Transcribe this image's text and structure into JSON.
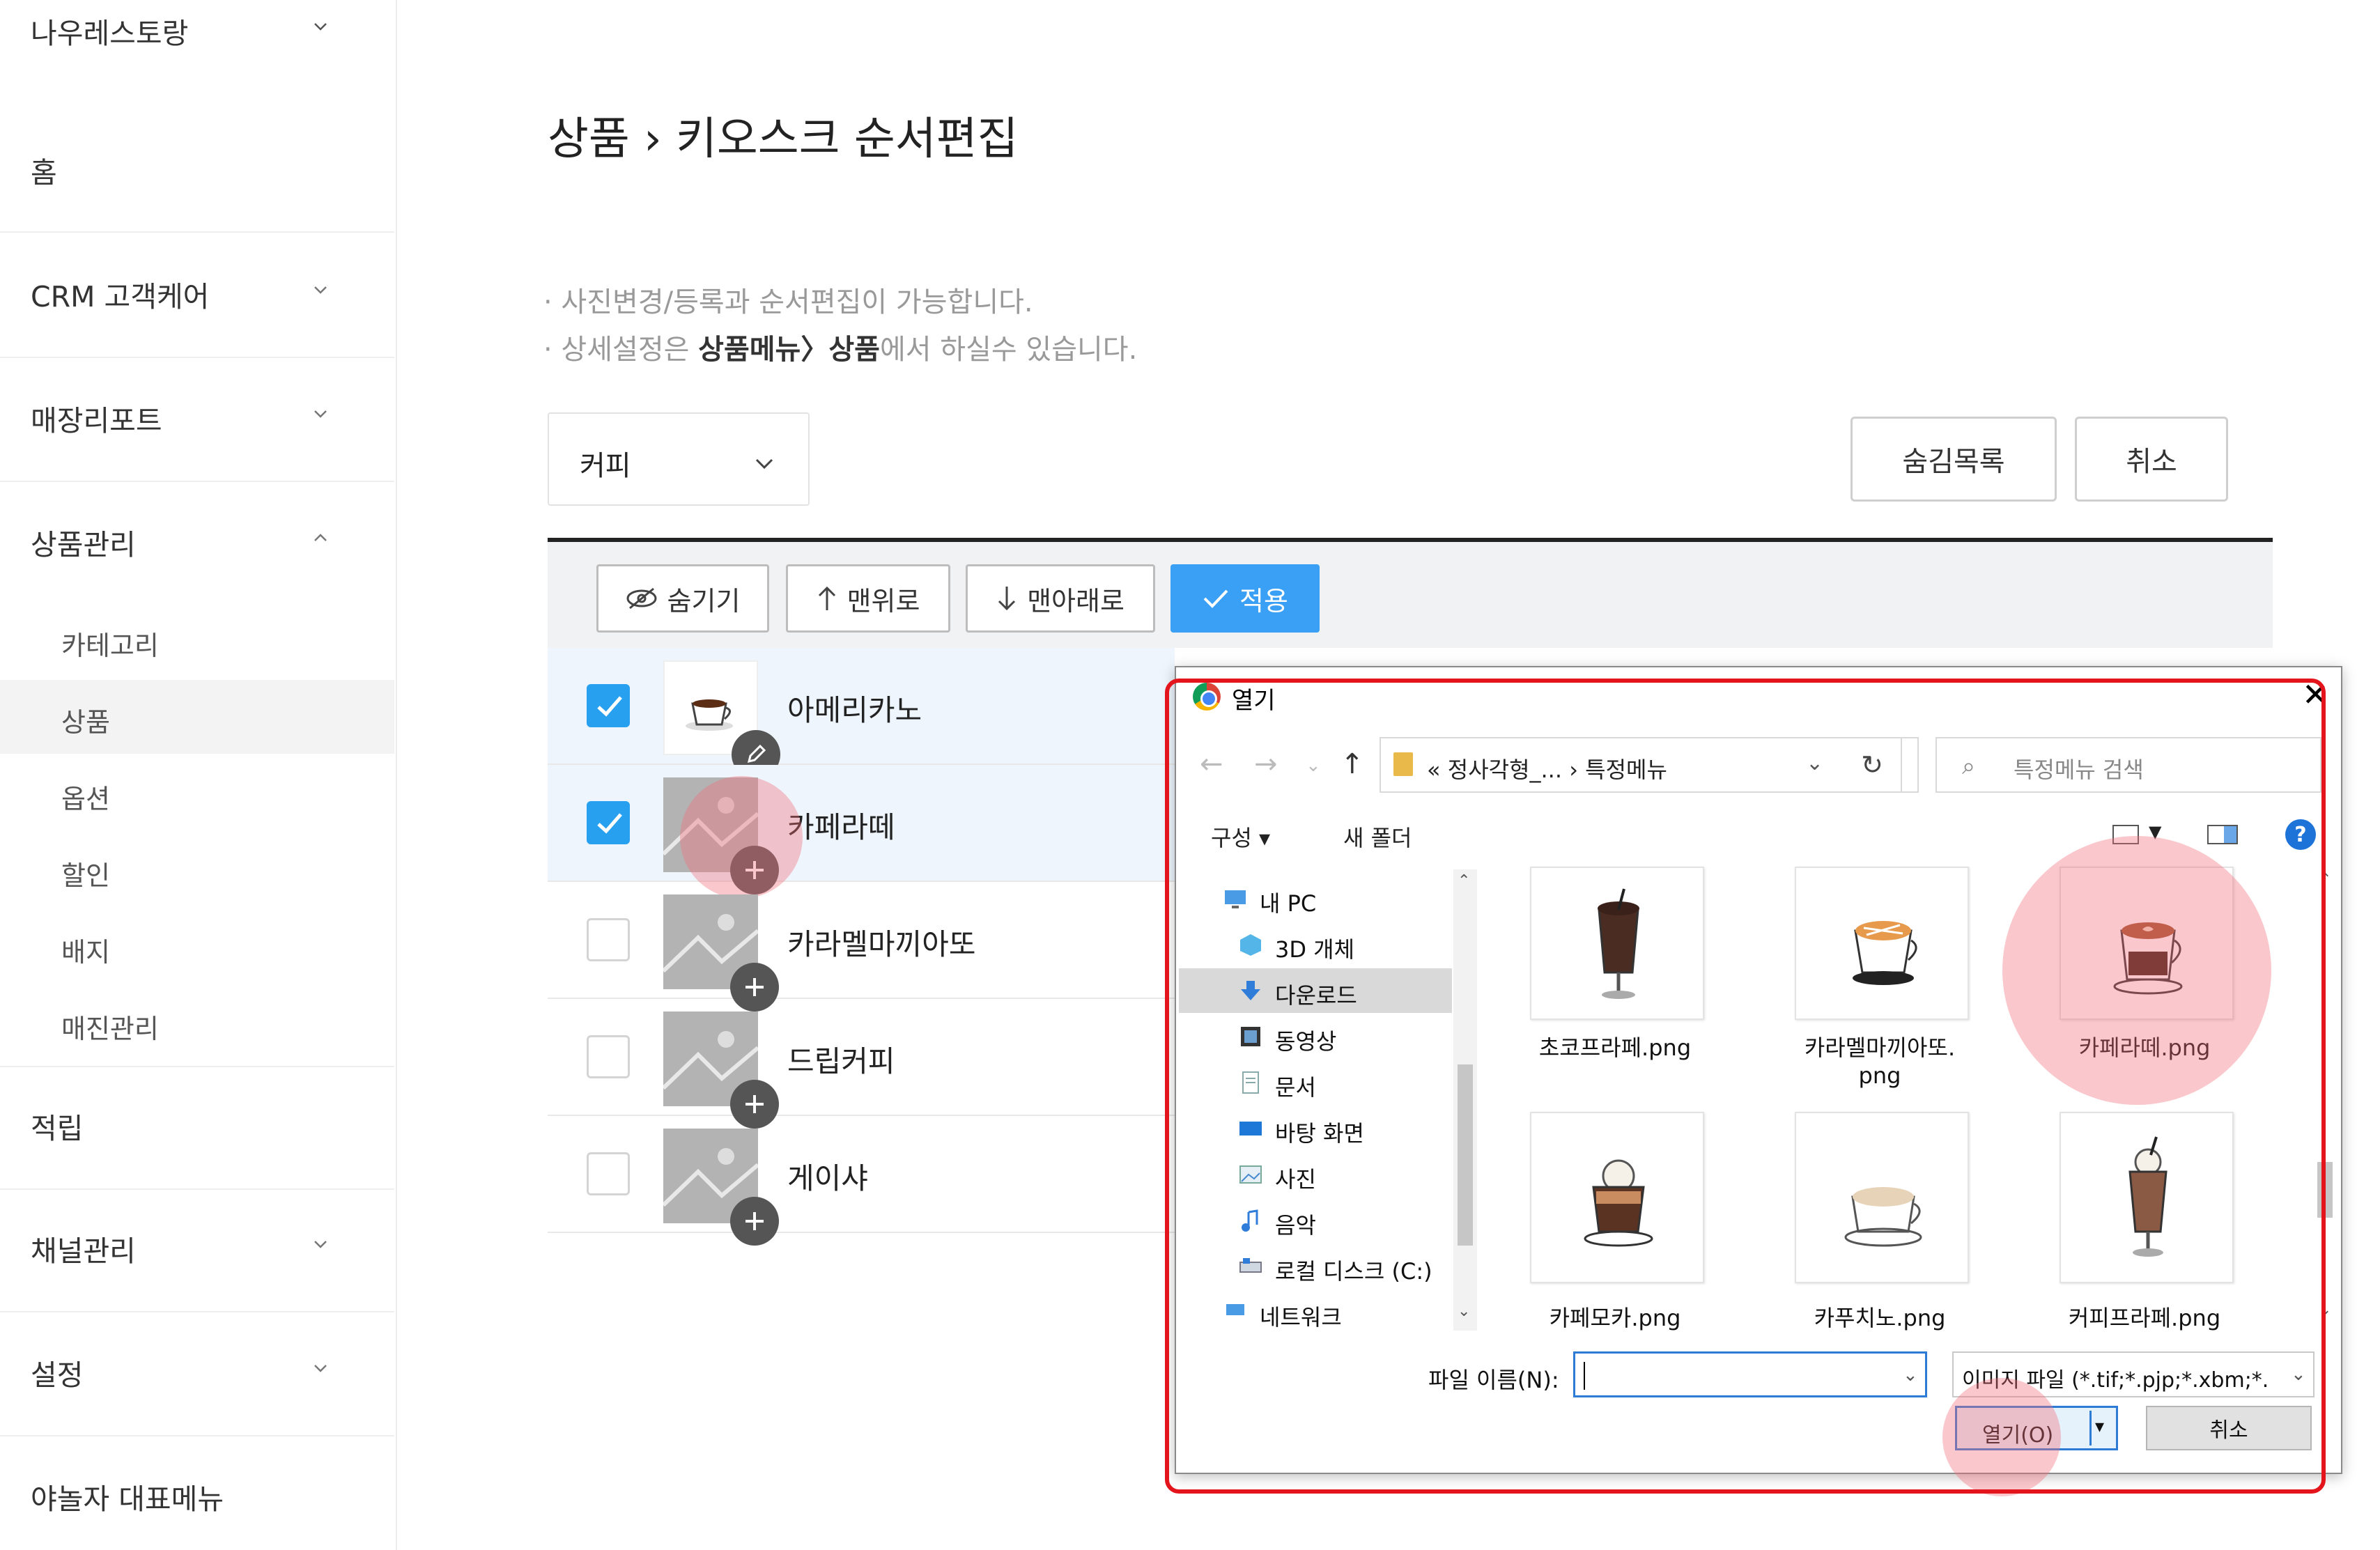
{
  "sidebar": {
    "store_name": "나우레스토랑",
    "items": [
      {
        "label": "홈"
      },
      {
        "label": "CRM 고객케어"
      },
      {
        "label": "매장리포트"
      },
      {
        "label": "상품관리"
      },
      {
        "label": "적립"
      },
      {
        "label": "채널관리"
      },
      {
        "label": "설정"
      },
      {
        "label": "야놀자 대표메뉴"
      }
    ],
    "sub_items": [
      {
        "label": "카테고리"
      },
      {
        "label": "상품",
        "active": true
      },
      {
        "label": "옵션"
      },
      {
        "label": "할인"
      },
      {
        "label": "배지"
      },
      {
        "label": "매진관리"
      }
    ]
  },
  "page": {
    "title": "상품 › 키오스크 순서편집",
    "note1": "· 사진변경/등록과 순서편집이 가능합니다.",
    "note2_prefix": "· 상세설정은 ",
    "note2_bold": "상품메뉴〉상품",
    "note2_suffix": "에서 하실수 있습니다."
  },
  "category_select": {
    "value": "커피"
  },
  "buttons": {
    "hidden_list": "숨김목록",
    "cancel": "취소",
    "hide": "숨기기",
    "to_top": "맨위로",
    "to_bottom": "맨아래로",
    "apply": "적용"
  },
  "products": [
    {
      "name": "아메리카노",
      "checked": true,
      "has_photo": true
    },
    {
      "name": "카페라떼",
      "checked": true,
      "has_photo": false
    },
    {
      "name": "카라멜마끼아또",
      "checked": false,
      "has_photo": false
    },
    {
      "name": "드립커피",
      "checked": false,
      "has_photo": false
    },
    {
      "name": "게이샤",
      "checked": false,
      "has_photo": false
    }
  ],
  "dialog": {
    "title": "열기",
    "path": "« 정사각형_...  ›  특정메뉴",
    "search_placeholder": "특정메뉴 검색",
    "organize": "구성 ▾",
    "new_folder": "새 폴더",
    "tree": [
      {
        "label": "내 PC",
        "icon": "pc-icon"
      },
      {
        "label": "3D 개체",
        "icon": "cube-icon"
      },
      {
        "label": "다운로드",
        "icon": "download-icon",
        "active": true
      },
      {
        "label": "동영상",
        "icon": "video-icon"
      },
      {
        "label": "문서",
        "icon": "document-icon"
      },
      {
        "label": "바탕 화면",
        "icon": "desktop-icon"
      },
      {
        "label": "사진",
        "icon": "picture-icon"
      },
      {
        "label": "음악",
        "icon": "music-icon"
      },
      {
        "label": "로컬 디스크 (C:)",
        "icon": "disk-icon"
      },
      {
        "label": "네트워크",
        "icon": "network-icon"
      }
    ],
    "files": [
      {
        "name": "초코프라페.png",
        "color": "#4a2c22"
      },
      {
        "name": "카라멜마끼아또.",
        "name2": "png",
        "color": "#c9875a"
      },
      {
        "name": "카페라떼.png",
        "color": "#a4532f"
      },
      {
        "name": "카페모카.png",
        "color": "#5a3322"
      },
      {
        "name": "카푸치노.png",
        "color": "#d9c4a6"
      },
      {
        "name": "커피프라페.png",
        "color": "#8a5a44"
      }
    ],
    "filename_label": "파일 이름(N):",
    "filename_value": "",
    "filter": "이미지 파일 (*.tif;*.pjp;*.xbm;*.",
    "open": "열기(O)",
    "cancel": "취소"
  }
}
